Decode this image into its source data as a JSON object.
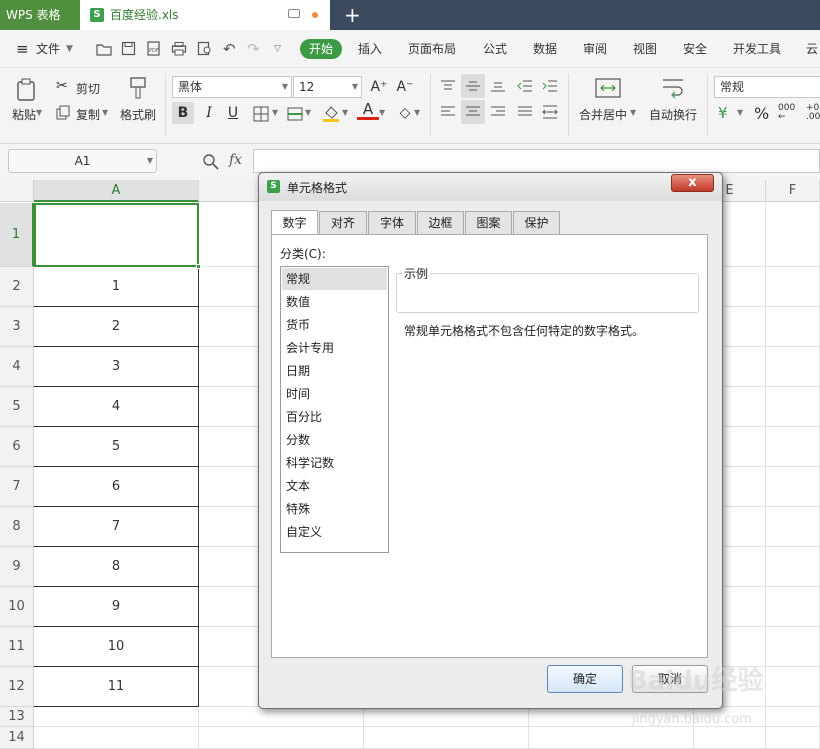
{
  "app": {
    "name": "WPS 表格",
    "doc_tab": "百度经验.xls"
  },
  "menu": {
    "file": "文件",
    "tabs": [
      "开始",
      "插入",
      "页面布局",
      "公式",
      "数据",
      "审阅",
      "视图",
      "安全",
      "开发工具",
      "云"
    ]
  },
  "ribbon": {
    "paste": "粘贴",
    "cut": "剪切",
    "copy": "复制",
    "format_painter": "格式刷",
    "font_name": "黑体",
    "font_size": "12",
    "bold": "B",
    "italic": "I",
    "underline": "U",
    "merge_center": "合并居中",
    "wrap_text": "自动换行",
    "number_format": "常规",
    "percent": "%"
  },
  "formula_bar": {
    "name_box": "A1",
    "fx": "fx",
    "value": ""
  },
  "sheet": {
    "columns": [
      "A",
      "E",
      "F"
    ],
    "rows": [
      "1",
      "2",
      "3",
      "4",
      "5",
      "6",
      "7",
      "8",
      "9",
      "10",
      "11",
      "12",
      "13",
      "14"
    ],
    "values": [
      "",
      "1",
      "2",
      "3",
      "4",
      "5",
      "6",
      "7",
      "8",
      "9",
      "10",
      "11",
      "",
      ""
    ]
  },
  "dialog": {
    "title": "单元格格式",
    "close": "x",
    "tabs": [
      "数字",
      "对齐",
      "字体",
      "边框",
      "图案",
      "保护"
    ],
    "category_label": "分类(C):",
    "categories": [
      "常规",
      "数值",
      "货币",
      "会计专用",
      "日期",
      "时间",
      "百分比",
      "分数",
      "科学记数",
      "文本",
      "特殊",
      "自定义"
    ],
    "sample_label": "示例",
    "description": "常规单元格格式不包含任何特定的数字格式。",
    "ok": "确定",
    "cancel": "取消"
  },
  "watermark": {
    "logo": "Baidu经验",
    "url": "jingyan.baidu.com"
  },
  "colors": {
    "titlebar": "#3b4a5c",
    "brand_green": "#4f8f3d",
    "start_pill": "#3c9a45",
    "selection": "#3b8f3b"
  }
}
